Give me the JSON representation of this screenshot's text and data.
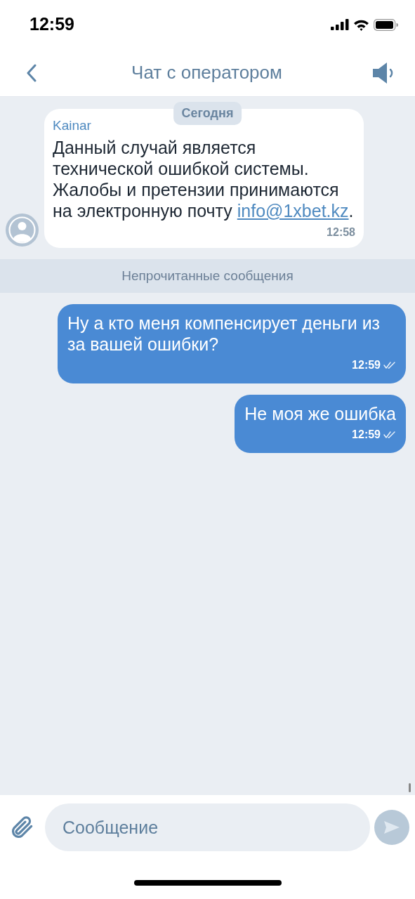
{
  "status_bar": {
    "time": "12:59"
  },
  "header": {
    "title": "Чат с оператором"
  },
  "date_label": "Сегодня",
  "messages": [
    {
      "kind": "incoming",
      "sender": "Kainar",
      "text": "Данный случай является технической ошибкой системы. Жалобы и претензии принимаются на электронную почту",
      "link": "info@1xbet.kz",
      "after_link": ".",
      "time": "12:58"
    },
    {
      "kind": "divider",
      "text": "Непрочитанные сообщения"
    },
    {
      "kind": "outgoing",
      "text": "Ну а кто меня компенсирует деньги из за вашей ошибки?",
      "time": "12:59",
      "read": true
    },
    {
      "kind": "outgoing",
      "text": "Не моя же ошибка",
      "time": "12:59",
      "read": true
    }
  ],
  "composer": {
    "placeholder": "Сообщение"
  }
}
